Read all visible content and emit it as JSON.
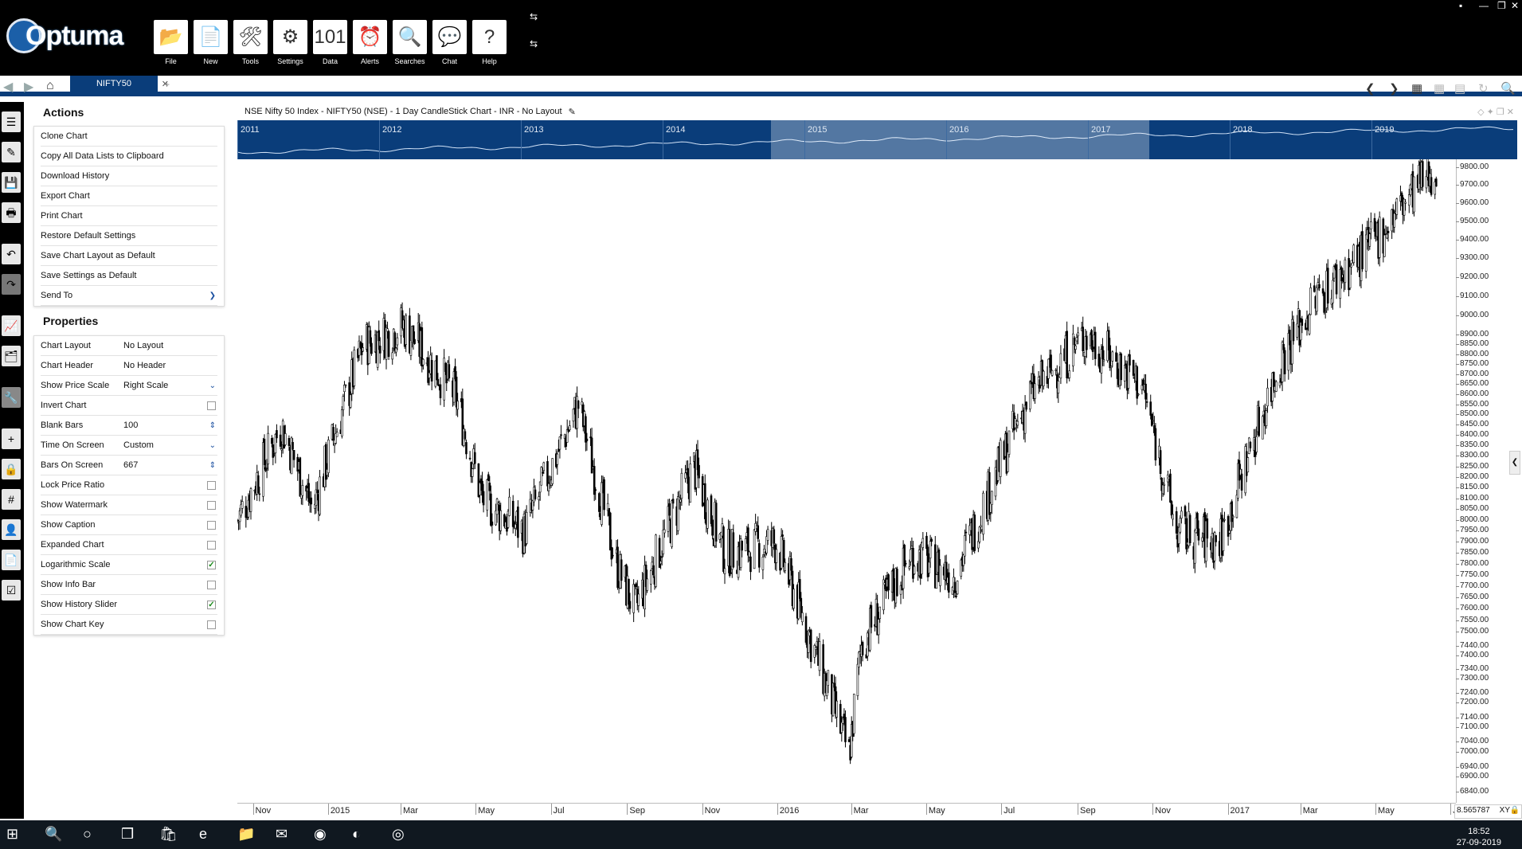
{
  "app": {
    "logo_text": "Optuma",
    "toolbar": [
      {
        "label": "File",
        "icon": "folder-icon",
        "glyph": "📂"
      },
      {
        "label": "New",
        "icon": "new-chart-icon",
        "glyph": "📄"
      },
      {
        "label": "Tools",
        "icon": "tools-icon",
        "glyph": "🛠"
      },
      {
        "label": "Settings",
        "icon": "gear-icon",
        "glyph": "⚙"
      },
      {
        "label": "Data",
        "icon": "binary-data-icon",
        "glyph": "101"
      },
      {
        "label": "Alerts",
        "icon": "alarm-clock-icon",
        "glyph": "⏰"
      },
      {
        "label": "Searches",
        "icon": "search-icon",
        "glyph": "🔍"
      },
      {
        "label": "Chat",
        "icon": "chat-bubbles-icon",
        "glyph": "💬"
      },
      {
        "label": "Help",
        "icon": "question-icon",
        "glyph": "?"
      }
    ]
  },
  "tabs": {
    "active": "NIFTY50"
  },
  "actions": {
    "title": "Actions",
    "items": [
      "Clone Chart",
      "Copy All Data Lists to Clipboard",
      "Download History",
      "Export Chart",
      "Print Chart",
      "Restore Default Settings",
      "Save Chart Layout as Default",
      "Save Settings as Default",
      "Send To"
    ]
  },
  "properties": {
    "title": "Properties",
    "items": [
      {
        "label": "Chart Layout",
        "value": "No Layout",
        "control": "text"
      },
      {
        "label": "Chart Header",
        "value": "No Header",
        "control": "text"
      },
      {
        "label": "Show Price Scale",
        "value": "Right Scale",
        "control": "dropdown"
      },
      {
        "label": "Invert Chart",
        "value": "",
        "control": "checkbox",
        "checked": false
      },
      {
        "label": "Blank Bars",
        "value": "100",
        "control": "spinner"
      },
      {
        "label": "Time On Screen",
        "value": "Custom",
        "control": "dropdown"
      },
      {
        "label": "Bars On Screen",
        "value": "667",
        "control": "spinner"
      },
      {
        "label": "Lock Price Ratio",
        "value": "",
        "control": "checkbox",
        "checked": false
      },
      {
        "label": "Show Watermark",
        "value": "",
        "control": "checkbox",
        "checked": false
      },
      {
        "label": "Show Caption",
        "value": "",
        "control": "checkbox",
        "checked": false
      },
      {
        "label": "Expanded Chart",
        "value": "",
        "control": "checkbox",
        "checked": false
      },
      {
        "label": "Logarithmic Scale",
        "value": "",
        "control": "checkbox",
        "checked": true
      },
      {
        "label": "Show Info Bar",
        "value": "",
        "control": "checkbox",
        "checked": false
      },
      {
        "label": "Show History Slider",
        "value": "",
        "control": "checkbox",
        "checked": true
      },
      {
        "label": "Show Chart Key",
        "value": "",
        "control": "checkbox",
        "checked": false
      }
    ]
  },
  "chart": {
    "header": "NSE Nifty 50 Index - NIFTY50 (NSE) - 1 Day CandleStick Chart - INR - No Layout",
    "slider_years": [
      "2011",
      "2012",
      "2013",
      "2014",
      "2015",
      "2016",
      "2017",
      "2018",
      "2019"
    ],
    "x_ticks": [
      "Nov",
      "2015",
      "Mar",
      "May",
      "Jul",
      "Sep",
      "Nov",
      "2016",
      "Mar",
      "May",
      "Jul",
      "Sep",
      "Nov",
      "2017",
      "Mar",
      "May",
      "Ju"
    ],
    "y_ticks": [
      "9800.00",
      "9700.00",
      "9600.00",
      "9500.00",
      "9400.00",
      "9300.00",
      "9200.00",
      "9100.00",
      "9000.00",
      "8900.00",
      "8850.00",
      "8800.00",
      "8750.00",
      "8700.00",
      "8650.00",
      "8600.00",
      "8550.00",
      "8500.00",
      "8450.00",
      "8400.00",
      "8350.00",
      "8300.00",
      "8250.00",
      "8200.00",
      "8150.00",
      "8100.00",
      "8050.00",
      "8000.00",
      "7950.00",
      "7900.00",
      "7850.00",
      "7800.00",
      "7750.00",
      "7700.00",
      "7650.00",
      "7600.00",
      "7550.00",
      "7500.00",
      "7440.00",
      "7400.00",
      "7340.00",
      "7300.00",
      "7240.00",
      "7200.00",
      "7140.00",
      "7100.00",
      "7040.00",
      "7000.00",
      "6940.00",
      "6900.00",
      "6840.00"
    ],
    "crosshair_readout": "8.565787",
    "crosshair_mode": "XY"
  },
  "chart_data": {
    "type": "candlestick",
    "series_name": "NIFTY50",
    "log_scale": true,
    "ylim": [
      6800,
      9850
    ],
    "x_range": [
      "2014-10",
      "2017-07"
    ],
    "close_path": [
      {
        "date": "2014-10-20",
        "close": 8000
      },
      {
        "date": "2014-11-25",
        "close": 8450
      },
      {
        "date": "2014-12-20",
        "close": 8050
      },
      {
        "date": "2015-01-30",
        "close": 8850
      },
      {
        "date": "2015-03-04",
        "close": 8950
      },
      {
        "date": "2015-04-15",
        "close": 8600
      },
      {
        "date": "2015-05-07",
        "close": 8100
      },
      {
        "date": "2015-06-10",
        "close": 7950
      },
      {
        "date": "2015-07-24",
        "close": 8550
      },
      {
        "date": "2015-08-24",
        "close": 7800
      },
      {
        "date": "2015-09-08",
        "close": 7600
      },
      {
        "date": "2015-10-26",
        "close": 8250
      },
      {
        "date": "2015-11-20",
        "close": 7850
      },
      {
        "date": "2016-01-01",
        "close": 7900
      },
      {
        "date": "2016-02-29",
        "close": 6990
      },
      {
        "date": "2016-03-10",
        "close": 7450
      },
      {
        "date": "2016-04-20",
        "close": 7850
      },
      {
        "date": "2016-05-25",
        "close": 7750
      },
      {
        "date": "2016-07-25",
        "close": 8600
      },
      {
        "date": "2016-09-08",
        "close": 8900
      },
      {
        "date": "2016-10-24",
        "close": 8650
      },
      {
        "date": "2016-11-21",
        "close": 7950
      },
      {
        "date": "2016-12-26",
        "close": 7900
      },
      {
        "date": "2017-02-15",
        "close": 8800
      },
      {
        "date": "2017-03-15",
        "close": 9100
      },
      {
        "date": "2017-04-25",
        "close": 9350
      },
      {
        "date": "2017-05-30",
        "close": 9650
      },
      {
        "date": "2017-06-20",
        "close": 9800
      }
    ]
  }
}
